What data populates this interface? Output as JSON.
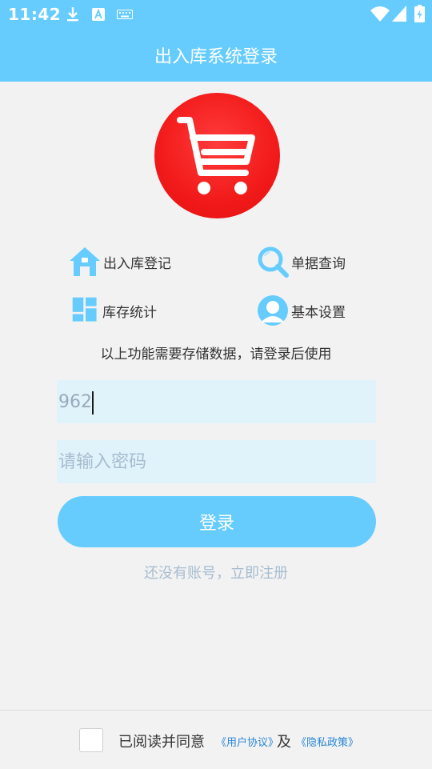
{
  "status_bar": {
    "time": "11:42",
    "icons": [
      "download-icon",
      "a-notification-icon",
      "keyboard-icon",
      "wifi-icon",
      "signal-icon",
      "battery-icon"
    ]
  },
  "app_bar": {
    "title": "出入库系统登录"
  },
  "logo": {
    "icon": "shopping-cart-icon",
    "color": "#f21a1a"
  },
  "features": [
    {
      "label": "出入库登记",
      "icon": "home-icon"
    },
    {
      "label": "单据查询",
      "icon": "search-icon"
    },
    {
      "label": "库存统计",
      "icon": "dashboard-tiles-icon"
    },
    {
      "label": "基本设置",
      "icon": "user-icon"
    }
  ],
  "hint": "以上功能需要存储数据，请登录后使用",
  "form": {
    "username_value": "962",
    "password_placeholder": "请输入密码",
    "login_label": "登录",
    "register_link": "还没有账号，立即注册"
  },
  "footer": {
    "agree_text": "已阅读并同意",
    "user_agreement": "《用户协议》",
    "and_text": "及",
    "privacy_policy": "《隐私政策》"
  },
  "colors": {
    "primary": "#66ccfe",
    "input_bg": "#e0f3fb",
    "link": "#2a86d6",
    "muted": "#a7bcd0"
  }
}
